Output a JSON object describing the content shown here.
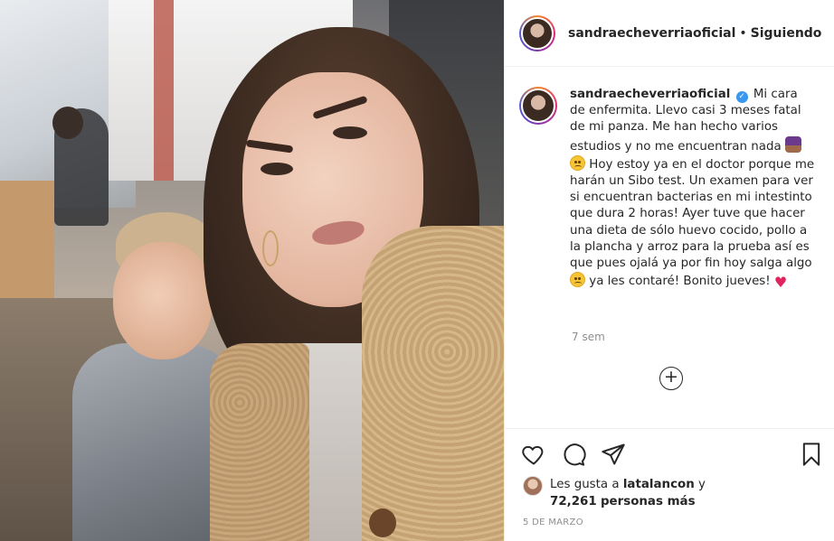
{
  "header": {
    "username": "sandraecheverriaoficial",
    "separator": "•",
    "follow_status": "Siguiendo"
  },
  "caption": {
    "username": "sandraecheverriaoficial",
    "verified": true,
    "text_1": "Mi cara de enfermita. Llevo casi 3 meses fatal de mi panza. Me han hecho varios estudios y no me encuentran nada",
    "emoji_1": "person-shrugging-emoji",
    "emoji_2": "slightly-frowning-face-emoji",
    "text_2": "Hoy estoy ya en el doctor porque me harán un Sibo test. Un examen para ver si encuentran bacterias en mi intestinto que dura 2 horas! Ayer tuve que hacer una dieta de sólo huevo cocido, pollo a la plancha y arroz para la prueba así es que pues ojalá ya por fin hoy salga algo",
    "emoji_3": "worried-face-emoji",
    "text_3": "ya les contaré! Bonito jueves!",
    "emoji_4": "red-heart-emoji",
    "timestamp": "7 sem"
  },
  "load_more": {
    "icon": "plus-circle-icon",
    "glyph": "+"
  },
  "actions": {
    "like_icon": "heart-outline-icon",
    "comment_icon": "comment-bubble-icon",
    "share_icon": "paper-plane-icon",
    "save_icon": "bookmark-icon"
  },
  "likes": {
    "prefix": "Les gusta a",
    "liker": "latalancon",
    "conjunction": "y",
    "count": "72,261",
    "suffix": "personas más"
  },
  "post_date": "5 DE MARZO",
  "colors": {
    "verified": "#3897f0",
    "text": "#262626",
    "muted": "#8e8e8e",
    "border": "#efefef"
  }
}
